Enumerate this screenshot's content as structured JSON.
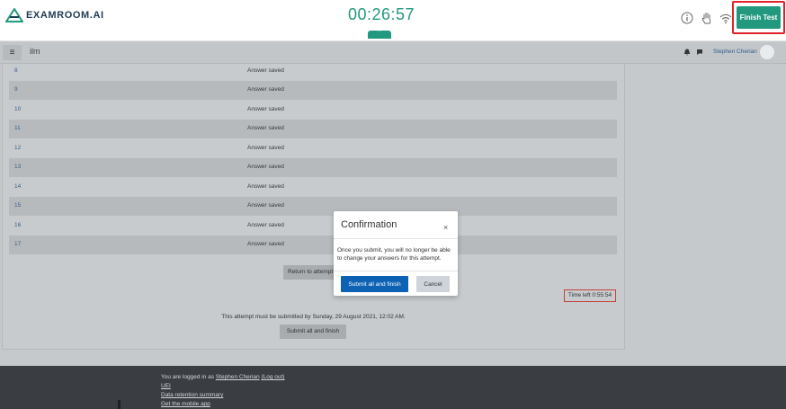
{
  "header": {
    "logo_text": "EXAMROOM.AI",
    "timer": "00:26:57",
    "finish_label": "Finish Test",
    "accent_color": "#22987e",
    "icons": [
      "info-icon",
      "raise-hand-icon",
      "wifi-icon"
    ]
  },
  "navbar": {
    "site_name": "ilm",
    "user_name": "Stephen Cherian"
  },
  "summary": {
    "rows": [
      {
        "num": "8",
        "status": "Answer saved"
      },
      {
        "num": "9",
        "status": "Answer saved"
      },
      {
        "num": "10",
        "status": "Answer saved"
      },
      {
        "num": "11",
        "status": "Answer saved"
      },
      {
        "num": "12",
        "status": "Answer saved"
      },
      {
        "num": "13",
        "status": "Answer saved"
      },
      {
        "num": "14",
        "status": "Answer saved"
      },
      {
        "num": "15",
        "status": "Answer saved"
      },
      {
        "num": "16",
        "status": "Answer saved"
      },
      {
        "num": "17",
        "status": "Answer saved"
      }
    ],
    "return_label": "Return to attempt",
    "time_left": "Time left 0:55:54",
    "deadline_text": "This attempt must be submitted by Sunday, 29 August 2021, 12:02 AM.",
    "submit_label": "Submit all and finish"
  },
  "footer": {
    "logged_in_prefix": "You are logged in as ",
    "user_link": "Stephen Cherian",
    "logout_link": "(Log out)",
    "link_1": "UEI",
    "link_2": "Data retention summary",
    "link_3": "Get the mobile app"
  },
  "modal": {
    "title": "Confirmation",
    "close_symbol": "×",
    "body": "Once you submit, you will no longer be able to change your answers for this attempt.",
    "submit_label": "Submit all and finish",
    "cancel_label": "Cancel"
  }
}
